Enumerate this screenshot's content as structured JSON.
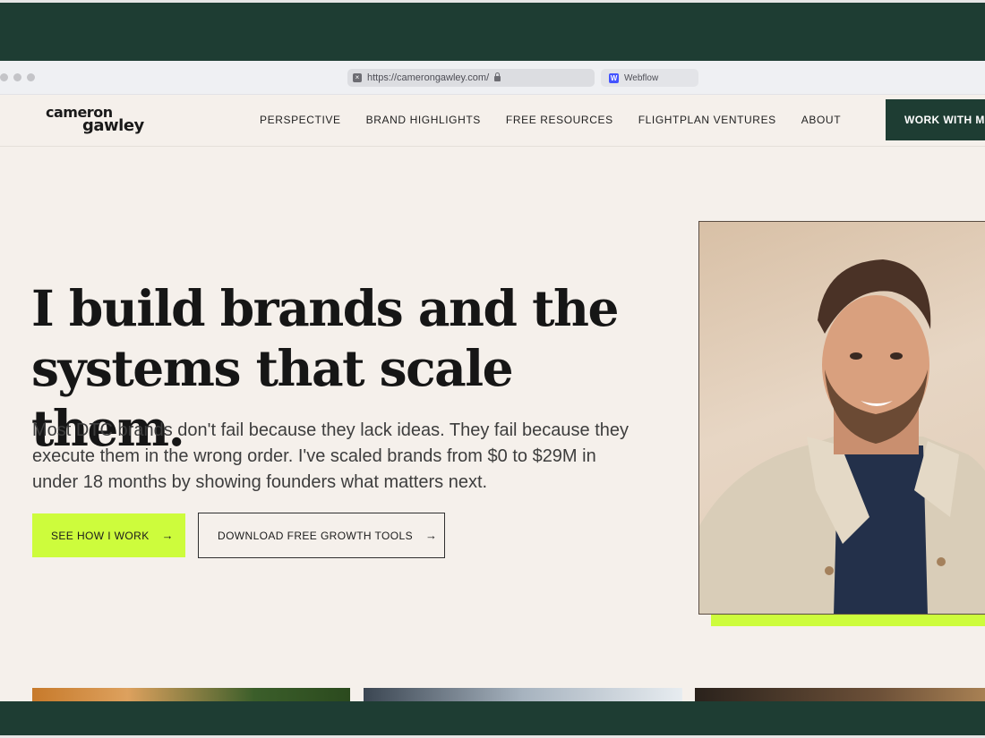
{
  "browser": {
    "url": "https://camerongawley.com/",
    "tab_label": "Webflow"
  },
  "nav": {
    "logo_line1": "cameron",
    "logo_line2": "gawley",
    "links": [
      "PERSPECTIVE",
      "BRAND HIGHLIGHTS",
      "FREE RESOURCES",
      "FLIGHTPLAN VENTURES",
      "ABOUT"
    ],
    "cta": "WORK WITH ME"
  },
  "hero": {
    "headline_line1": "I build brands and the",
    "headline_line2": "systems that scale them.",
    "subtext": "Most DTC brands don't fail because they lack ideas. They fail because they execute them in the wrong order. I've scaled brands from $0 to $29M in under 18 months by showing founders what matters next.",
    "primary_button": "SEE HOW I WORK",
    "secondary_button": "DOWNLOAD FREE GROWTH TOOLS",
    "arrow": "→"
  },
  "colors": {
    "accent_lime": "#cdfc3c",
    "brand_green": "#1e3d33",
    "page_bg": "#f5f0eb"
  },
  "icons": {
    "favicon": "×",
    "webflow": "W"
  }
}
